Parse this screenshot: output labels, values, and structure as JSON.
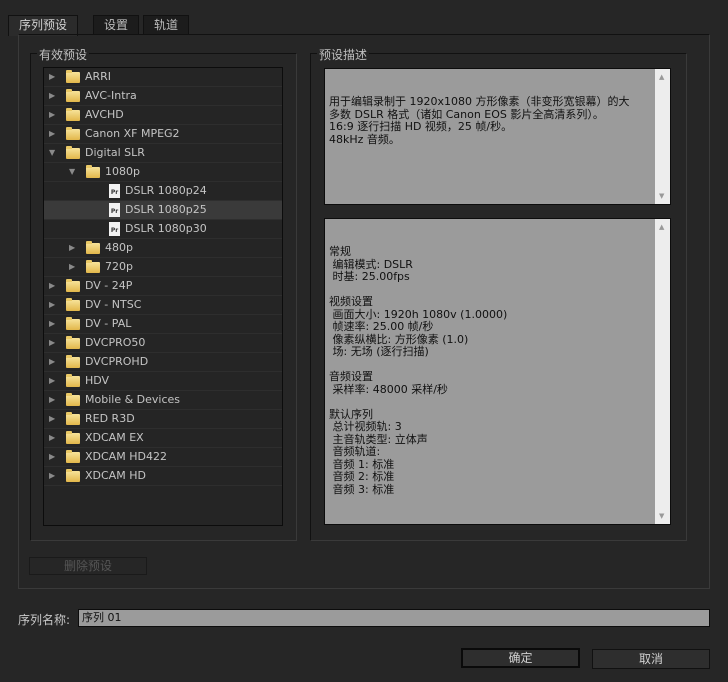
{
  "tabs": [
    "序列预设",
    "设置",
    "轨道"
  ],
  "presets_title": "有效预设",
  "description_title": "预设描述",
  "tree": [
    {
      "label": "ARRI",
      "level": 0,
      "type": "folder",
      "expanded": false
    },
    {
      "label": "AVC-Intra",
      "level": 0,
      "type": "folder",
      "expanded": false
    },
    {
      "label": "AVCHD",
      "level": 0,
      "type": "folder",
      "expanded": false
    },
    {
      "label": "Canon XF MPEG2",
      "level": 0,
      "type": "folder",
      "expanded": false
    },
    {
      "label": "Digital SLR",
      "level": 0,
      "type": "folder",
      "expanded": true
    },
    {
      "label": "1080p",
      "level": 1,
      "type": "folder",
      "expanded": true
    },
    {
      "label": "DSLR 1080p24",
      "level": 2,
      "type": "file"
    },
    {
      "label": "DSLR 1080p25",
      "level": 2,
      "type": "file",
      "selected": true
    },
    {
      "label": "DSLR 1080p30",
      "level": 2,
      "type": "file"
    },
    {
      "label": "480p",
      "level": 1,
      "type": "folder",
      "expanded": false
    },
    {
      "label": "720p",
      "level": 1,
      "type": "folder",
      "expanded": false
    },
    {
      "label": "DV - 24P",
      "level": 0,
      "type": "folder",
      "expanded": false
    },
    {
      "label": "DV - NTSC",
      "level": 0,
      "type": "folder",
      "expanded": false
    },
    {
      "label": "DV - PAL",
      "level": 0,
      "type": "folder",
      "expanded": false
    },
    {
      "label": "DVCPRO50",
      "level": 0,
      "type": "folder",
      "expanded": false
    },
    {
      "label": "DVCPROHD",
      "level": 0,
      "type": "folder",
      "expanded": false
    },
    {
      "label": "HDV",
      "level": 0,
      "type": "folder",
      "expanded": false
    },
    {
      "label": "Mobile & Devices",
      "level": 0,
      "type": "folder",
      "expanded": false
    },
    {
      "label": "RED R3D",
      "level": 0,
      "type": "folder",
      "expanded": false
    },
    {
      "label": "XDCAM EX",
      "level": 0,
      "type": "folder",
      "expanded": false
    },
    {
      "label": "XDCAM HD422",
      "level": 0,
      "type": "folder",
      "expanded": false
    },
    {
      "label": "XDCAM HD",
      "level": 0,
      "type": "folder",
      "expanded": false
    }
  ],
  "file_icon_text": "Pr",
  "description": "用于编辑录制于 1920x1080 方形像素（非变形宽银幕）的大\n多数 DSLR 格式（诸如 Canon EOS 影片全高清系列）。\n16:9 逐行扫描 HD 视频，25 帧/秒。\n48kHz 音频。",
  "details": "常规\n 编辑模式: DSLR\n 时基: 25.00fps\n\n视频设置\n 画面大小: 1920h 1080v (1.0000)\n 帧速率: 25.00 帧/秒\n 像素纵横比: 方形像素 (1.0)\n 场: 无场 (逐行扫描)\n\n音频设置\n 采样率: 48000 采样/秒\n\n默认序列\n 总计视频轨: 3\n 主音轨类型: 立体声\n 音频轨道:\n 音频 1: 标准\n 音频 2: 标准\n 音频 3: 标准",
  "delete_preset": "删除预设",
  "sequence_name_label": "序列名称:",
  "sequence_name_value": "序列 01",
  "ok": "确定",
  "cancel": "取消"
}
